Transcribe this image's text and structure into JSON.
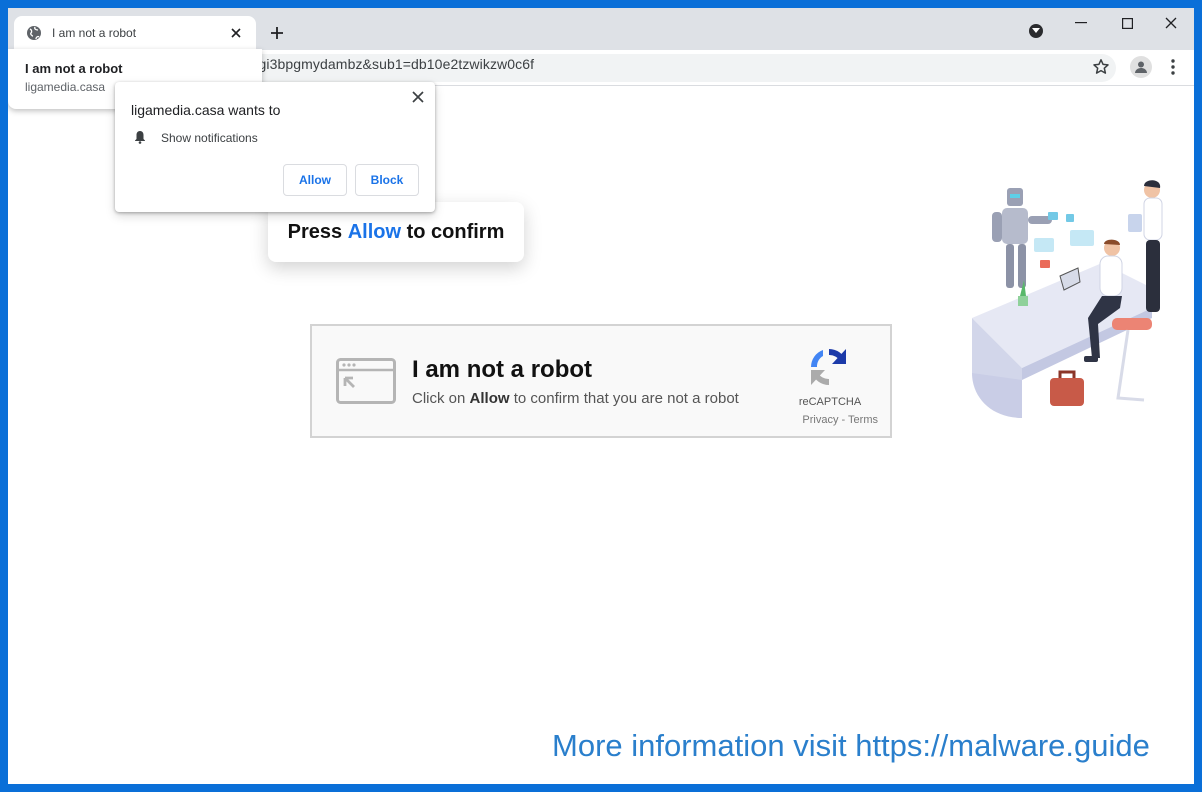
{
  "browser": {
    "tab": {
      "title": "I am not a robot"
    },
    "hover_card": {
      "title": "I am not a robot",
      "domain": "ligamedia.casa"
    },
    "url": "=gm4dcylegm5gi3bpgmydambz&sub1=db10e2tzwikzw0c6f"
  },
  "permission_prompt": {
    "title": "ligamedia.casa wants to",
    "permission": "Show notifications",
    "allow_label": "Allow",
    "block_label": "Block"
  },
  "page": {
    "press_prefix": "Press",
    "press_highlight": "Allow",
    "press_suffix": "to confirm",
    "captcha": {
      "title": "I am not a robot",
      "sub_prefix": "Click on",
      "sub_bold": "Allow",
      "sub_suffix": "to confirm that you are not a robot",
      "brand": "reCAPTCHA",
      "links": "Privacy - Terms"
    }
  },
  "watermark": "More information visit https://malware.guide",
  "colors": {
    "accent": "#1a73e8",
    "desktop": "#0a6fd8",
    "watermark": "#2a7fcc"
  }
}
